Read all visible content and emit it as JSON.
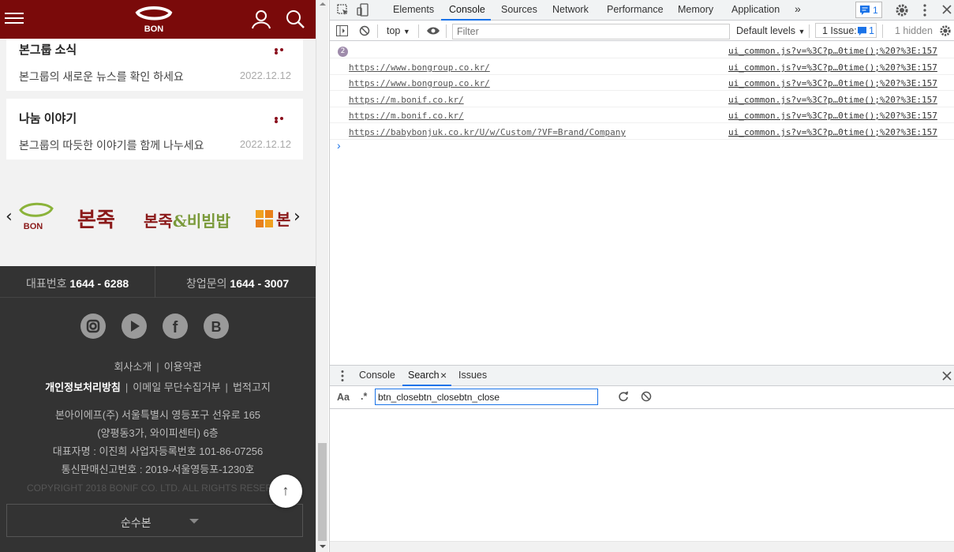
{
  "mobile": {
    "header": {
      "logo_text": "BON"
    },
    "cards": [
      {
        "title": "본그룹 소식",
        "desc": "본그룹의 새로운 뉴스를 확인 하세요",
        "date": "2022.12.12"
      },
      {
        "title": "나눔 이야기",
        "desc": "본그룹의 따듯한 이야기를 함께 나누세요",
        "date": "2022.12.12"
      }
    ],
    "brands": {
      "prev": "‹",
      "next": "›",
      "b1": "BON",
      "b2": "본죽",
      "b3_a": "본죽",
      "b3_b": "&비빔밥",
      "b4": "본"
    },
    "footer": {
      "phone1_label": "대표번호",
      "phone1": "1644 - 6288",
      "phone2_label": "창업문의",
      "phone2": "1644 - 3007",
      "social": [
        "instagram-icon",
        "youtube-icon",
        "facebook-icon",
        "blog-icon"
      ],
      "link_company": "회사소개",
      "link_terms": "이용약관",
      "link_privacy": "개인정보처리방침",
      "link_email": "이메일 무단수집거부",
      "link_legal": "법적고지",
      "addr1": "본아이에프(주) 서울특별시 영등포구 선유로 165",
      "addr2": "(양평동3가, 와이피센터) 6층",
      "addr3": "대표자명 : 이진희 사업자등록번호 101-86-07256",
      "addr4": "통신판매신고번호 : 2019-서울영등포-1230호",
      "copyright": "COPYRIGHT 2018 BONIF CO. LTD. ALL RIGHTS RESERVED.",
      "top_button": "↑",
      "brand_select": "순수본"
    }
  },
  "devtools": {
    "tabs": [
      "Elements",
      "Console",
      "Sources",
      "Network",
      "Performance",
      "Memory",
      "Application"
    ],
    "more_tabs": "»",
    "issues_count": "1",
    "console_toolbar": {
      "context": "top",
      "filter_placeholder": "Filter",
      "levels": "Default levels",
      "issues_label": "1 Issue:",
      "issues_num": "1",
      "hidden": "1 hidden"
    },
    "logs": [
      {
        "badge": "2",
        "url": "",
        "source": "ui_common.js?v=%3C?p…0time();%20?%3E:157"
      },
      {
        "url": "https://www.bongroup.co.kr/",
        "source": "ui_common.js?v=%3C?p…0time();%20?%3E:157"
      },
      {
        "url": "https://www.bongroup.co.kr/",
        "source": "ui_common.js?v=%3C?p…0time();%20?%3E:157"
      },
      {
        "url": "https://m.bonif.co.kr/",
        "source": "ui_common.js?v=%3C?p…0time();%20?%3E:157"
      },
      {
        "url": "https://m.bonif.co.kr/",
        "source": "ui_common.js?v=%3C?p…0time();%20?%3E:157"
      },
      {
        "url": "https://babybonjuk.co.kr/U/w/Custom/?VF=Brand/Company",
        "source": "ui_common.js?v=%3C?p…0time();%20?%3E:157"
      }
    ],
    "prompt": "›",
    "drawer": {
      "tabs": [
        "Console",
        "Search",
        "Issues"
      ],
      "close_tab": "×",
      "case_toggle": "Aa",
      "regex_toggle": ".*",
      "search_value": "btn_closebtn_closebtn_close"
    },
    "colors": {
      "accent": "#1a73e8",
      "brand": "#7a0a0a"
    }
  }
}
